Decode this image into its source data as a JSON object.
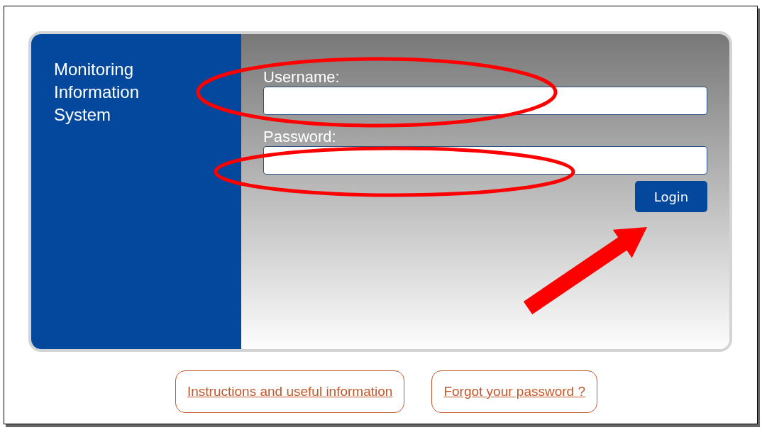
{
  "sidebar": {
    "title": "Monitoring Information System"
  },
  "form": {
    "fields": [
      {
        "label": "Username:"
      },
      {
        "label": "Password:"
      }
    ],
    "submit": "Login"
  },
  "links": [
    "Instructions and useful information",
    "Forgot your password ?"
  ],
  "annotations": [
    {
      "kind": "ellipse"
    },
    {
      "kind": "ellipse"
    },
    {
      "kind": "arrow"
    }
  ]
}
